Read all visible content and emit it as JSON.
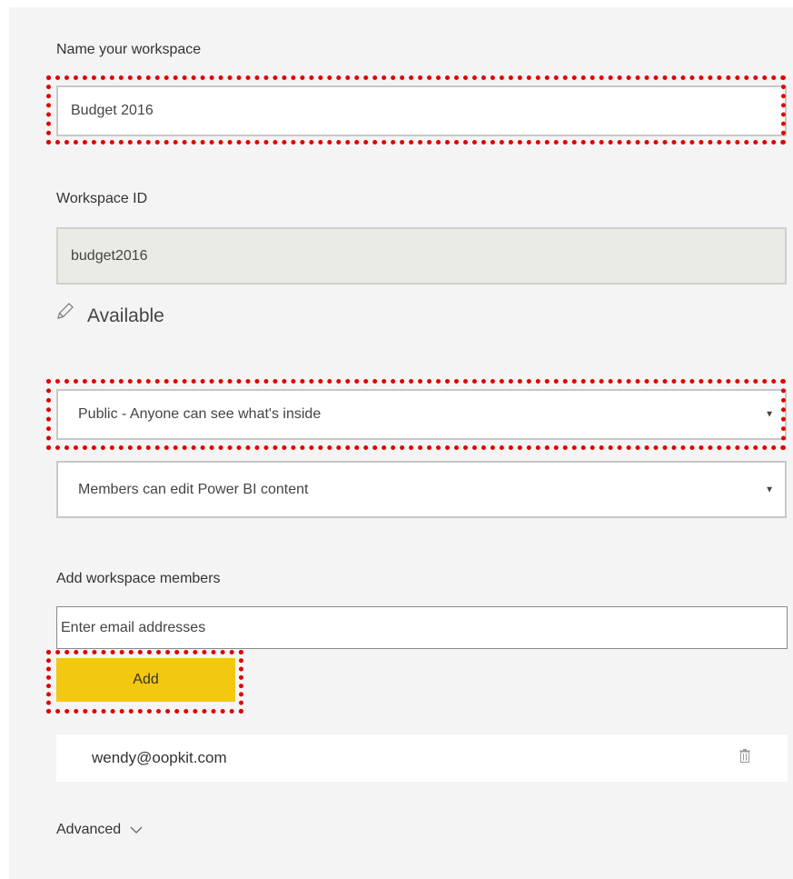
{
  "workspace_name": {
    "label": "Name your workspace",
    "value": "Budget 2016"
  },
  "workspace_id": {
    "label": "Workspace ID",
    "value": "budget2016",
    "status": "Available",
    "status_icon": "pencil-icon"
  },
  "privacy_select": {
    "selected": "Public - Anyone can see what's inside"
  },
  "permission_select": {
    "selected": "Members can edit Power BI content"
  },
  "members": {
    "label": "Add workspace members",
    "placeholder": "Enter email addresses",
    "add_label": "Add",
    "list": [
      {
        "email": "wendy@oopkit.com",
        "icon": "trash-icon"
      }
    ]
  },
  "advanced": {
    "label": "Advanced",
    "icon": "chevron-down-icon"
  },
  "colors": {
    "add_button": "#f2c811",
    "highlight": "#e00000",
    "panel_bg": "#f4f4f4",
    "readonly_bg": "#ebebe6"
  }
}
